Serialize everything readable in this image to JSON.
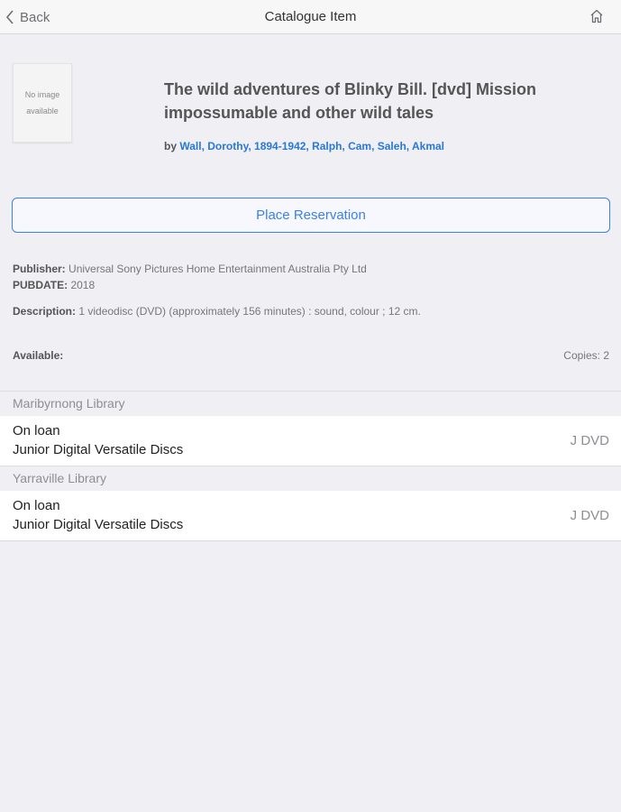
{
  "nav": {
    "back_label": "Back",
    "title": "Catalogue Item",
    "home_icon": "home-icon"
  },
  "item": {
    "cover_text": "No image available",
    "title": "The wild adventures of Blinky Bill. [dvd] Mission impossumable and other wild tales",
    "by_prefix": "by",
    "authors": "Wall, Dorothy, 1894-1942, Ralph, Cam, Saleh, Akmal"
  },
  "reserve_label": "Place Reservation",
  "details": {
    "publisher_label": "Publisher:",
    "publisher": "Universal Sony Pictures Home Entertainment Australia Pty Ltd",
    "pubdate_label": "PUBDATE:",
    "pubdate": "2018",
    "description_label": "Description:",
    "description": "1 videodisc (DVD) (approximately 156 minutes) : sound, colour ; 12 cm."
  },
  "availability": {
    "label": "Available:",
    "copies": "Copies: 2"
  },
  "holdings": [
    {
      "library": "Maribyrnong Library",
      "status": "On loan",
      "collection": "Junior Digital Versatile Discs",
      "call_number": "J DVD"
    },
    {
      "library": "Yarraville Library",
      "status": "On loan",
      "collection": "Junior Digital Versatile Discs",
      "call_number": "J DVD"
    }
  ],
  "colors": {
    "accent": "#3b7ff0",
    "link": "#2a78d6",
    "background": "#efeff4"
  }
}
